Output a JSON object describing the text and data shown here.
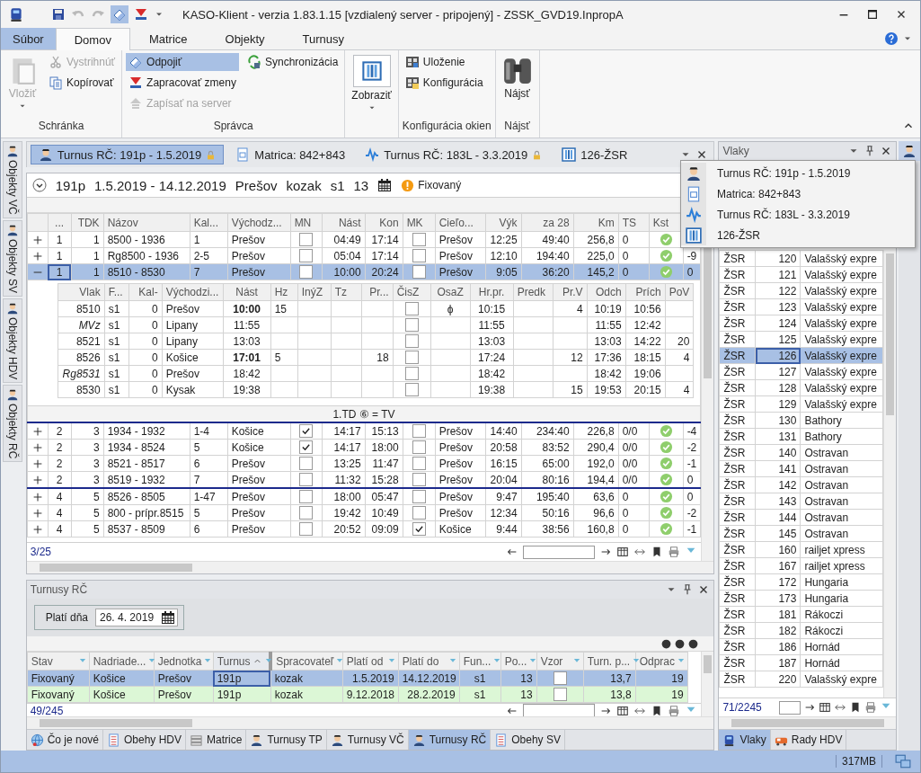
{
  "window": {
    "title": "KASO-Klient - verzia 1.83.1.15 [vzdialený server - pripojený] - ZSSK_GVD19.InpropA"
  },
  "ribbon": {
    "tabs": [
      {
        "label": "Súbor",
        "kind": "file",
        "selected": false
      },
      {
        "label": "Domov",
        "kind": "tab",
        "selected": true
      },
      {
        "label": "Matrice",
        "kind": "tab",
        "selected": false
      },
      {
        "label": "Objekty",
        "kind": "tab",
        "selected": false
      },
      {
        "label": "Turnusy",
        "kind": "tab",
        "selected": false
      }
    ],
    "groups": [
      {
        "label": "Schránka",
        "columns": [
          [
            {
              "label": "Vložiť",
              "kind": "large",
              "disabled": true,
              "on": false,
              "dropdown": true
            }
          ],
          [
            {
              "label": "Vystrihnúť",
              "kind": "small",
              "disabled": true,
              "on": false,
              "dropdown": false
            },
            {
              "label": "Kopírovať",
              "kind": "small",
              "disabled": false,
              "on": false,
              "dropdown": false
            }
          ]
        ]
      },
      {
        "label": "Správca",
        "columns": [
          [
            {
              "label": "Odpojiť",
              "kind": "small",
              "disabled": false,
              "on": true,
              "dropdown": false
            },
            {
              "label": "Zapracovať zmeny",
              "kind": "small",
              "disabled": false,
              "on": false,
              "dropdown": false
            },
            {
              "label": "Zapísať na server",
              "kind": "small",
              "disabled": true,
              "on": false,
              "dropdown": false
            }
          ],
          [
            {
              "label": "Synchronizácia",
              "kind": "small",
              "disabled": false,
              "on": false,
              "dropdown": false
            }
          ]
        ]
      },
      {
        "columns": [
          [
            {
              "label": "Zobraziť",
              "kind": "large",
              "disabled": false,
              "on": false,
              "dropdown": true
            }
          ]
        ]
      },
      {
        "label": "Konfigurácia okien",
        "columns": [
          [
            {
              "label": "Uloženie",
              "kind": "small",
              "disabled": false,
              "on": false,
              "dropdown": false
            },
            {
              "label": "Konfigurácia",
              "kind": "small",
              "disabled": false,
              "on": false,
              "dropdown": false
            }
          ]
        ]
      },
      {
        "label": "Nájsť",
        "columns": [
          [
            {
              "label": "Nájsť",
              "kind": "large",
              "disabled": false,
              "on": false,
              "dropdown": false
            }
          ]
        ]
      }
    ]
  },
  "side_tabs": [
    {
      "label": "Objekty VČ"
    },
    {
      "label": "Objekty SV"
    },
    {
      "label": "Objekty HDV"
    },
    {
      "label": "Objekty RČ"
    }
  ],
  "documents": {
    "tabs": [
      {
        "label": "Turnus RČ: 191p - 1.5.2019",
        "kind": "crew",
        "selected": true,
        "locked": true
      },
      {
        "label": "Matrica: 842+843",
        "kind": "matrix",
        "selected": false,
        "locked": false
      },
      {
        "label": "Turnus RČ: 183L - 3.3.2019",
        "kind": "graph",
        "selected": false,
        "locked": true
      },
      {
        "label": "126-ŽSR",
        "kind": "table",
        "selected": false,
        "locked": false
      }
    ],
    "menu": [
      {
        "label": "Turnus RČ: 191p - 1.5.2019",
        "kind": "crew"
      },
      {
        "label": "Matrica: 842+843",
        "kind": "matrix"
      },
      {
        "label": "Turnus RČ: 183L - 3.3.2019",
        "kind": "graph"
      },
      {
        "label": "126-ŽSR",
        "kind": "table"
      }
    ]
  },
  "turnus": {
    "summary": {
      "name": "191p",
      "period": "1.5.2019 - 14.12.2019",
      "depot": "Prešov",
      "author": "kozak",
      "function": "s1",
      "days": "13",
      "state": "Fixovaný"
    },
    "grid": {
      "columns": [
        "...",
        "TDK",
        "Názov",
        "Kal...",
        "Východz...",
        "MN",
        "Nást",
        "Kon",
        "MK",
        "Cieľo...",
        "Výk",
        "za 28",
        "Km",
        "TS",
        "Kst"
      ],
      "groups": [
        {
          "rows": [
            {
              "selected": false,
              "expanded": false,
              "no": "1",
              "tdk": "1",
              "name": "8500 - 1936",
              "cal": "1",
              "from": "Prešov",
              "mn": false,
              "dep": "04:49",
              "arr": "17:14",
              "mk": false,
              "to": "Prešov",
              "perf": "12:25",
              "za28": "49:40",
              "km": "256,8",
              "ts": "0",
              "kst": true
            },
            {
              "selected": false,
              "expanded": false,
              "no": "1",
              "tdk": "1",
              "name": "Rg8500 - 1936",
              "cal": "2-5",
              "from": "Prešov",
              "mn": false,
              "dep": "05:04",
              "arr": "17:14",
              "mk": false,
              "to": "Prešov",
              "perf": "12:10",
              "za28": "194:40",
              "km": "225,0",
              "ts": "0",
              "kst": true,
              "extra": "-9"
            },
            {
              "selected": true,
              "expanded": true,
              "no": "1",
              "tdk": "1",
              "name": "8510 - 8530",
              "cal": "7",
              "from": "Prešov",
              "mn": false,
              "dep": "10:00",
              "arr": "20:24",
              "mk": false,
              "to": "Prešov",
              "perf": "9:05",
              "za28": "36:20",
              "km": "145,2",
              "ts": "0",
              "kst": true,
              "extra": "0",
              "detail": {
                "columns": [
                  "Vlak",
                  "F...",
                  "Kal-",
                  "Východzi...",
                  "Nást",
                  "Hz",
                  "InýZ",
                  "Tz",
                  "Pr...",
                  "ČisZ",
                  "OsaZ",
                  "Hr.pr.",
                  "Predk",
                  "Pr.V",
                  "Odch",
                  "Prích",
                  "PoV"
                ],
                "rows": [
                  {
                    "vlak": "8510",
                    "service": false,
                    "f": "s1",
                    "cal": "0",
                    "from": "Prešov",
                    "dep": "10:00",
                    "dep_highlighted": true,
                    "hz": "15",
                    "cisz": false,
                    "osaz": "ϕ",
                    "hrpr": "10:15",
                    "prv": "4",
                    "odch": "10:19",
                    "prich": "10:56"
                  },
                  {
                    "vlak": "MVz",
                    "service": true,
                    "f": "s1",
                    "cal": "0",
                    "from": "Lipany",
                    "dep": "11:55",
                    "dep_highlighted": false,
                    "cisz": false,
                    "hrpr": "11:55",
                    "odch": "11:55",
                    "prich": "12:42"
                  },
                  {
                    "vlak": "8521",
                    "service": false,
                    "f": "s1",
                    "cal": "0",
                    "from": "Lipany",
                    "dep": "13:03",
                    "dep_highlighted": false,
                    "cisz": false,
                    "hrpr": "13:03",
                    "odch": "13:03",
                    "prich": "14:22",
                    "pov": "20"
                  },
                  {
                    "vlak": "8526",
                    "service": false,
                    "f": "s1",
                    "cal": "0",
                    "from": "Košice",
                    "dep": "17:01",
                    "dep_highlighted": true,
                    "hz": "5",
                    "pr": "18",
                    "cisz": false,
                    "hrpr": "17:24",
                    "prv": "12",
                    "odch": "17:36",
                    "prich": "18:15",
                    "pov": "4"
                  },
                  {
                    "vlak": "Rg8531",
                    "service": true,
                    "f": "s1",
                    "cal": "0",
                    "from": "Prešov",
                    "dep": "18:42",
                    "dep_highlighted": false,
                    "cisz": false,
                    "hrpr": "18:42",
                    "odch": "18:42",
                    "prich": "19:06"
                  },
                  {
                    "vlak": "8530",
                    "service": false,
                    "f": "s1",
                    "cal": "0",
                    "from": "Kysak",
                    "dep": "19:38",
                    "dep_highlighted": false,
                    "cisz": false,
                    "hrpr": "19:38",
                    "prv": "15",
                    "odch": "19:53",
                    "prich": "20:15",
                    "pov": "4"
                  }
                ]
              }
            }
          ],
          "footer": "1.TD ⑥ = TV"
        },
        {
          "rows": [
            {
              "selected": false,
              "expanded": false,
              "no": "2",
              "tdk": "3",
              "name": "1934 - 1932",
              "cal": "1-4",
              "from": "Košice",
              "mn": true,
              "dep": "14:17",
              "arr": "15:13",
              "mk": false,
              "to": "Prešov",
              "perf": "14:40",
              "za28": "234:40",
              "km": "226,8",
              "ts": "0/0",
              "kst": true,
              "extra": "-4"
            },
            {
              "selected": false,
              "expanded": false,
              "no": "2",
              "tdk": "3",
              "name": "1934 - 8524",
              "cal": "5",
              "from": "Košice",
              "mn": true,
              "dep": "14:17",
              "arr": "18:00",
              "mk": false,
              "to": "Prešov",
              "perf": "20:58",
              "za28": "83:52",
              "km": "290,4",
              "ts": "0/0",
              "kst": true,
              "extra": "-2"
            },
            {
              "selected": false,
              "expanded": false,
              "no": "2",
              "tdk": "3",
              "name": "8521 - 8517",
              "cal": "6",
              "from": "Prešov",
              "mn": false,
              "dep": "13:25",
              "arr": "11:47",
              "mk": false,
              "to": "Prešov",
              "perf": "16:15",
              "za28": "65:00",
              "km": "192,0",
              "ts": "0/0",
              "kst": true,
              "extra": "-1"
            },
            {
              "selected": false,
              "expanded": false,
              "no": "2",
              "tdk": "3",
              "name": "8519 - 1932",
              "cal": "7",
              "from": "Prešov",
              "mn": false,
              "dep": "11:32",
              "arr": "15:28",
              "mk": false,
              "to": "Prešov",
              "perf": "20:04",
              "za28": "80:16",
              "km": "194,4",
              "ts": "0/0",
              "kst": true,
              "extra": "0"
            }
          ]
        },
        {
          "rows": [
            {
              "selected": false,
              "expanded": false,
              "no": "4",
              "tdk": "5",
              "name": "8526 - 8505",
              "cal": "1-47",
              "from": "Prešov",
              "mn": false,
              "dep": "18:00",
              "arr": "05:47",
              "mk": false,
              "to": "Prešov",
              "perf": "9:47",
              "za28": "195:40",
              "km": "63,6",
              "ts": "0",
              "kst": true,
              "extra": "0"
            },
            {
              "selected": false,
              "expanded": false,
              "no": "4",
              "tdk": "5",
              "name": "800 - prípr.8515",
              "cal": "5",
              "from": "Prešov",
              "mn": false,
              "dep": "19:42",
              "arr": "10:49",
              "mk": false,
              "to": "Prešov",
              "perf": "12:34",
              "za28": "50:16",
              "km": "96,6",
              "ts": "0",
              "kst": true,
              "extra": "-2"
            },
            {
              "selected": false,
              "expanded": false,
              "no": "4",
              "tdk": "5",
              "name": "8537 - 8509",
              "cal": "6",
              "from": "Prešov",
              "mn": false,
              "dep": "20:52",
              "arr": "09:09",
              "mk": true,
              "to": "Košice",
              "perf": "9:44",
              "za28": "38:56",
              "km": "160,8",
              "ts": "0",
              "kst": true,
              "extra": "-1"
            }
          ]
        }
      ],
      "count": "3/25"
    }
  },
  "turnusy": {
    "title": "Turnusy RČ",
    "date_label": "Platí dňa",
    "date": "26. 4. 2019",
    "columns": [
      {
        "label": "Stav",
        "sorted": false
      },
      {
        "label": "Nadriade...",
        "sorted": false
      },
      {
        "label": "Jednotka",
        "sorted": false
      },
      {
        "label": "Turnus",
        "sorted": true
      },
      {
        "label": "Spracovateľ",
        "sorted": false
      },
      {
        "label": "Platí od",
        "sorted": false
      },
      {
        "label": "Platí do",
        "sorted": false
      },
      {
        "label": "Fun...",
        "sorted": false
      },
      {
        "label": "Po...",
        "sorted": false
      },
      {
        "label": "Vzor",
        "sorted": false
      },
      {
        "label": "Turn. p...",
        "sorted": false
      },
      {
        "label": "Odprac",
        "sorted": false
      }
    ],
    "rows": [
      {
        "selected": true,
        "stav": "Fixovaný",
        "sup": "Košice",
        "unit": "Prešov",
        "turnus": "191p",
        "proc": "kozak",
        "from": "1.5.2019",
        "to": "14.12.2019",
        "fun": "s1",
        "po": "13",
        "vzor": false,
        "tp": "13,7",
        "odp": "19"
      },
      {
        "selected": false,
        "color": "#dcf7d6",
        "stav": "Fixovaný",
        "sup": "Košice",
        "unit": "Prešov",
        "turnus": "191p",
        "proc": "kozak",
        "from": "9.12.2018",
        "to": "28.2.2019",
        "fun": "s1",
        "po": "13",
        "vzor": false,
        "tp": "13,8",
        "odp": "19"
      }
    ],
    "count": "49/245",
    "tabs": [
      {
        "label": "Čo je nové",
        "kind": "globe",
        "selected": false
      },
      {
        "label": "Obehy HDV",
        "kind": "list",
        "selected": false
      },
      {
        "label": "Matrice",
        "kind": "stack",
        "selected": false
      },
      {
        "label": "Turnusy TP",
        "kind": "crew",
        "selected": false
      },
      {
        "label": "Turnusy VČ",
        "kind": "crew",
        "selected": false
      },
      {
        "label": "Turnusy RČ",
        "kind": "crew",
        "selected": true
      },
      {
        "label": "Obehy SV",
        "kind": "list",
        "selected": false
      }
    ]
  },
  "vlaky": {
    "title": "Vlaky",
    "rows": [
      {
        "op": "ŽSR",
        "num": "120",
        "name": "Valašský expre",
        "selected": false
      },
      {
        "op": "ŽSR",
        "num": "121",
        "name": "Valašský expre",
        "selected": false
      },
      {
        "op": "ŽSR",
        "num": "122",
        "name": "Valašský expre",
        "selected": false
      },
      {
        "op": "ŽSR",
        "num": "123",
        "name": "Valašský expre",
        "selected": false
      },
      {
        "op": "ŽSR",
        "num": "124",
        "name": "Valašský expre",
        "selected": false
      },
      {
        "op": "ŽSR",
        "num": "125",
        "name": "Valašský expre",
        "selected": false
      },
      {
        "op": "ŽSR",
        "num": "126",
        "name": "Valašský expre",
        "selected": true
      },
      {
        "op": "ŽSR",
        "num": "127",
        "name": "Valašský expre",
        "selected": false
      },
      {
        "op": "ŽSR",
        "num": "128",
        "name": "Valašský expre",
        "selected": false
      },
      {
        "op": "ŽSR",
        "num": "129",
        "name": "Valašský expre",
        "selected": false
      },
      {
        "op": "ŽSR",
        "num": "130",
        "name": "Bathory",
        "selected": false
      },
      {
        "op": "ŽSR",
        "num": "131",
        "name": "Bathory",
        "selected": false
      },
      {
        "op": "ŽSR",
        "num": "140",
        "name": "Ostravan",
        "selected": false
      },
      {
        "op": "ŽSR",
        "num": "141",
        "name": "Ostravan",
        "selected": false
      },
      {
        "op": "ŽSR",
        "num": "142",
        "name": "Ostravan",
        "selected": false
      },
      {
        "op": "ŽSR",
        "num": "143",
        "name": "Ostravan",
        "selected": false
      },
      {
        "op": "ŽSR",
        "num": "144",
        "name": "Ostravan",
        "selected": false
      },
      {
        "op": "ŽSR",
        "num": "145",
        "name": "Ostravan",
        "selected": false
      },
      {
        "op": "ŽSR",
        "num": "160",
        "name": "railjet xpress",
        "selected": false
      },
      {
        "op": "ŽSR",
        "num": "167",
        "name": "railjet xpress",
        "selected": false
      },
      {
        "op": "ŽSR",
        "num": "172",
        "name": "Hungaria",
        "selected": false
      },
      {
        "op": "ŽSR",
        "num": "173",
        "name": "Hungaria",
        "selected": false
      },
      {
        "op": "ŽSR",
        "num": "181",
        "name": "Rákoczi",
        "selected": false
      },
      {
        "op": "ŽSR",
        "num": "182",
        "name": "Rákoczi",
        "selected": false
      },
      {
        "op": "ŽSR",
        "num": "186",
        "name": "Hornád",
        "selected": false
      },
      {
        "op": "ŽSR",
        "num": "187",
        "name": "Hornád",
        "selected": false
      },
      {
        "op": "ŽSR",
        "num": "220",
        "name": "Valašský expre",
        "selected": false
      }
    ],
    "count": "71/2245",
    "tabs": [
      {
        "label": "Vlaky",
        "kind": "train",
        "selected": true
      },
      {
        "label": "Rady HDV",
        "kind": "locomotive",
        "selected": false
      }
    ]
  },
  "status_bar": {
    "memory": "317MB"
  }
}
